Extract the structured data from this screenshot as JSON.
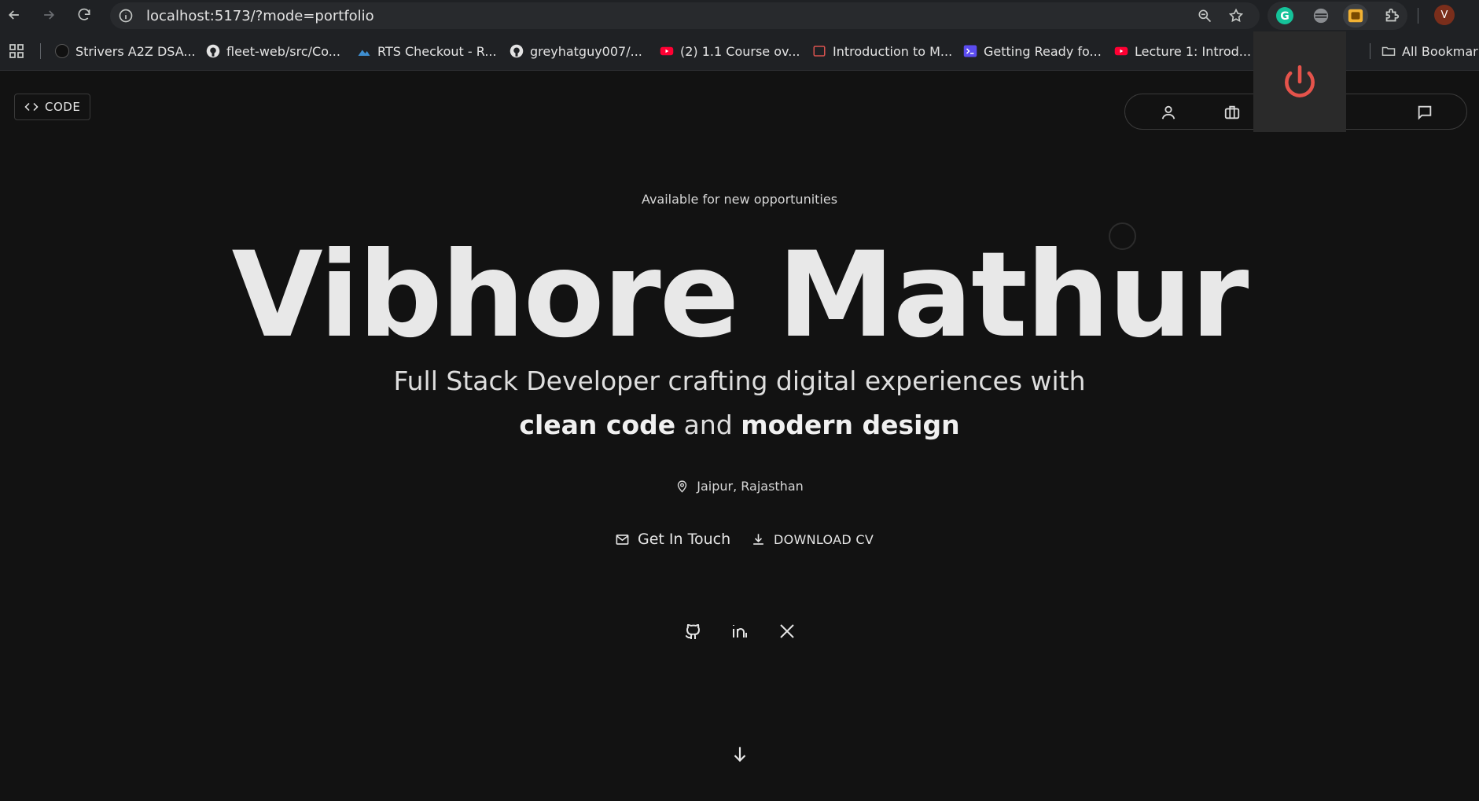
{
  "browser": {
    "url": "localhost:5173/?mode=portfolio",
    "profile_initial": "V",
    "bookmarks": [
      {
        "label": "Strivers A2Z DSA...",
        "icon": "tuf-icon"
      },
      {
        "label": "fleet-web/src/Co...",
        "icon": "github-icon"
      },
      {
        "label": "RTS Checkout - R...",
        "icon": "rts-icon"
      },
      {
        "label": "greyhatguy007/...",
        "icon": "github-icon"
      },
      {
        "label": "(2) 1.1 Course ov...",
        "icon": "youtube-icon"
      },
      {
        "label": "Introduction to M...",
        "icon": "course-icon"
      },
      {
        "label": "Getting Ready fo...",
        "icon": "terminal-icon"
      },
      {
        "label": "Lecture 1: Introd...",
        "icon": "youtube-icon"
      },
      {
        "label": "All Bookmarks",
        "icon": "folder-icon"
      }
    ]
  },
  "page": {
    "code_button": "CODE",
    "available": "Available for new opportunities",
    "name": "Vibhore Mathur",
    "tagline_line1": "Full Stack Developer crafting digital experiences with",
    "tagline_bold1": "clean code",
    "tagline_and": " and ",
    "tagline_bold2": "modern design",
    "location": "Jaipur, Rajasthan",
    "get_in_touch": "Get In Touch",
    "download_cv": "DOWNLOAD CV"
  },
  "colors": {
    "background": "#121212",
    "power_icon": "#e5534b"
  }
}
